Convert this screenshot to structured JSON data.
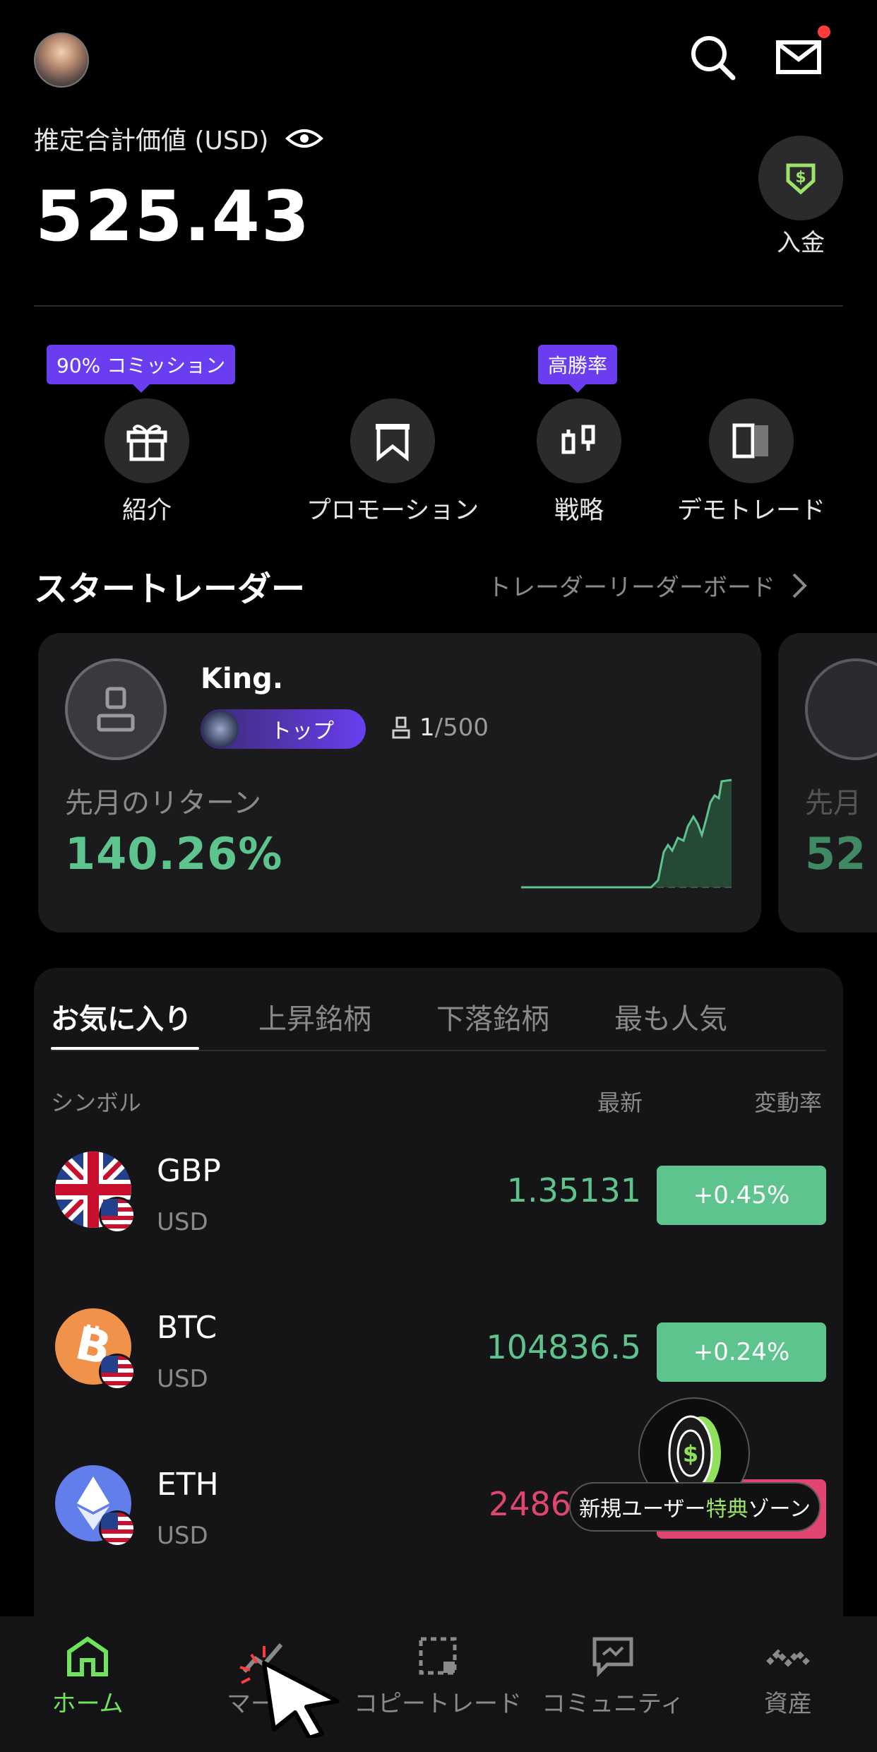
{
  "header": {
    "total_label": "推定合計価値 (USD)",
    "total_value": "525.43",
    "deposit_label": "入金"
  },
  "quick_actions": [
    {
      "label": "紹介",
      "tooltip": "90% コミッション",
      "icon": "gift-icon"
    },
    {
      "label": "プロモーション",
      "icon": "banner-icon"
    },
    {
      "label": "戦略",
      "tooltip": "高勝率",
      "icon": "candlestick-icon"
    },
    {
      "label": "デモトレード",
      "icon": "demo-icon"
    }
  ],
  "star_traders": {
    "title": "スタートレーダー",
    "link": "トレーダーリーダーボード",
    "card": {
      "name": "King.",
      "badge": "トップ",
      "followers_current": "1",
      "followers_max": "/500",
      "return_label": "先月のリターン",
      "return_value": "140.26%"
    },
    "next_card": {
      "return_label_partial": "先月",
      "return_value_partial": "52"
    }
  },
  "market": {
    "tabs": [
      "お気に入り",
      "上昇銘柄",
      "下落銘柄",
      "最も人気"
    ],
    "active_tab": 0,
    "columns": {
      "symbol": "シンボル",
      "latest": "最新",
      "change": "変動率"
    },
    "rows": [
      {
        "symbol": "GBP",
        "quote": "USD",
        "price": "1.35131",
        "change": "+0.45%",
        "direction": "up"
      },
      {
        "symbol": "BTC",
        "quote": "USD",
        "price": "104836.5",
        "change": "+0.24%",
        "direction": "up"
      },
      {
        "symbol": "ETH",
        "quote": "USD",
        "price": "2486",
        "change": "",
        "direction": "down"
      }
    ]
  },
  "promo": {
    "text_before": "新規ユーザー",
    "text_highlight": "特典",
    "text_after": "ゾーン"
  },
  "bottom_nav": [
    {
      "label": "ホーム",
      "icon": "home-icon",
      "active": true
    },
    {
      "label": "マーケ",
      "icon": "market-icon",
      "active": false
    },
    {
      "label": "コピートレード",
      "icon": "copy-trade-icon",
      "active": false
    },
    {
      "label": "コミュニティ",
      "icon": "community-icon",
      "active": false
    },
    {
      "label": "資産",
      "icon": "assets-icon",
      "active": false
    }
  ],
  "colors": {
    "up": "#5ec48d",
    "down": "#e0466f",
    "accent_purple": "#6a3ef0",
    "nav_active": "#6fe35a"
  }
}
